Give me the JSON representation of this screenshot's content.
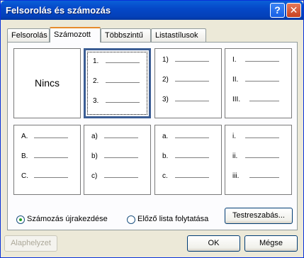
{
  "window": {
    "title": "Felsorolás és számozás",
    "help_label": "?",
    "close_label": "✕"
  },
  "tabs": [
    {
      "label": "Felsorolás"
    },
    {
      "label": "Számozott"
    },
    {
      "label": "Többszintű"
    },
    {
      "label": "Listastílusok"
    }
  ],
  "active_tab": "Számozott",
  "gallery": {
    "none_label": "Nincs",
    "styles": [
      {
        "markers": [
          "1.",
          "2.",
          "3."
        ]
      },
      {
        "markers": [
          "1)",
          "2)",
          "3)"
        ]
      },
      {
        "markers": [
          "I.",
          "II.",
          "III."
        ]
      },
      {
        "markers": [
          "A.",
          "B.",
          "C."
        ]
      },
      {
        "markers": [
          "a)",
          "b)",
          "c)"
        ]
      },
      {
        "markers": [
          "a.",
          "b.",
          "c."
        ]
      },
      {
        "markers": [
          "i.",
          "ii.",
          "iii."
        ]
      }
    ],
    "selected": "1."
  },
  "options": {
    "restart_label": "Számozás újrakezdése",
    "continue_label": "Előző lista folytatása",
    "selected": "restart"
  },
  "buttons": {
    "customize": "Testreszabás...",
    "reset": "Alaphelyzet",
    "ok": "OK",
    "cancel": "Mégse"
  }
}
